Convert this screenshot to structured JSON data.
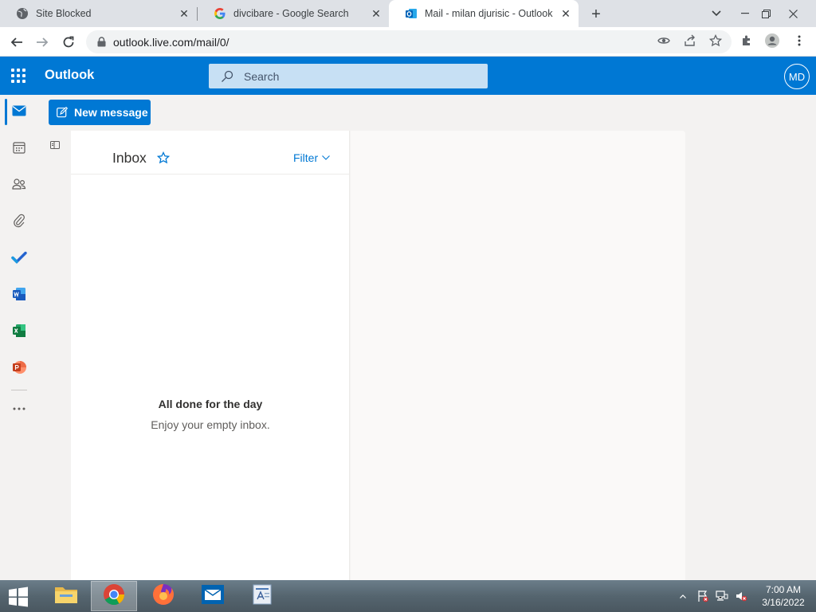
{
  "browser": {
    "tabs": [
      {
        "title": "Site Blocked",
        "icon": "globe-icon",
        "active": false
      },
      {
        "title": "divcibare - Google Search",
        "icon": "google-icon",
        "active": false
      },
      {
        "title": "Mail - milan djurisic - Outlook",
        "icon": "outlook-icon",
        "active": true
      }
    ],
    "url": "outlook.live.com/mail/0/"
  },
  "outlook": {
    "brand": "Outlook",
    "search_placeholder": "Search",
    "avatar_initials": "MD",
    "new_message_label": "New message",
    "rail": [
      "mail-icon",
      "calendar-icon",
      "people-icon",
      "attachment-icon",
      "todo-icon",
      "word-icon",
      "excel-icon",
      "powerpoint-icon",
      "more-icon"
    ],
    "list": {
      "title": "Inbox",
      "filter_label": "Filter",
      "empty_title": "All done for the day",
      "empty_subtitle": "Enjoy your empty inbox."
    },
    "colors": {
      "accent": "#0078d4",
      "rail_bg": "#f3f2f1"
    }
  },
  "taskbar": {
    "apps": [
      "file-explorer-icon",
      "chrome-icon",
      "firefox-icon",
      "mail-app-icon",
      "wordpad-icon"
    ],
    "time": "7:00 AM",
    "date": "3/16/2022"
  }
}
